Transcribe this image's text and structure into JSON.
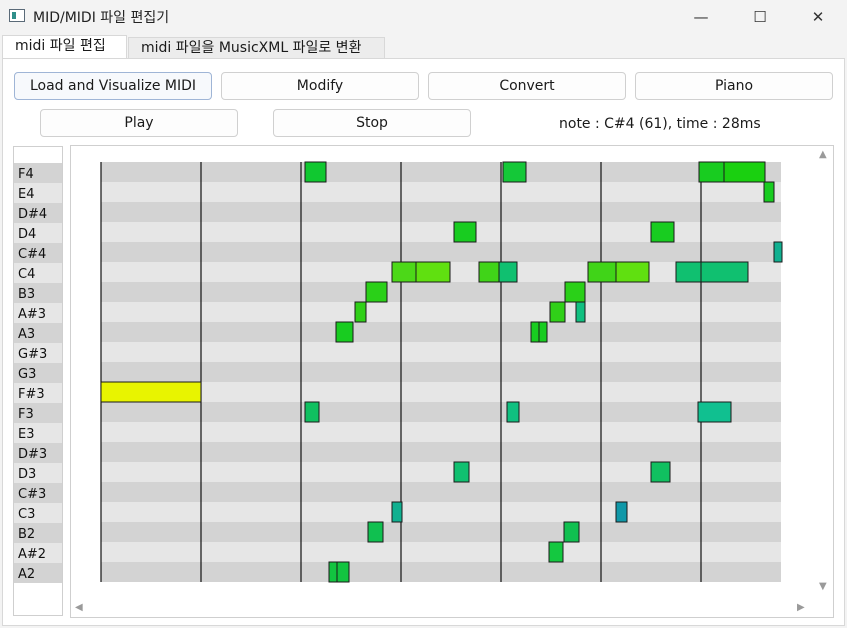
{
  "window": {
    "title": "MID/MIDI 파일 편집기",
    "minimize_icon": "—",
    "maximize_icon": "☐",
    "close_icon": "✕"
  },
  "tabs": [
    {
      "label": "midi 파일 편집",
      "active": true
    },
    {
      "label": "midi 파일을 MusicXML 파일로 변환",
      "active": false
    }
  ],
  "toolbar": {
    "load_label": "Load and Visualize MIDI",
    "modify_label": "Modify",
    "convert_label": "Convert",
    "piano_label": "Piano",
    "play_label": "Play",
    "stop_label": "Stop"
  },
  "status": {
    "text": "note : C#4 (61), time : 28ms"
  },
  "piano_roll": {
    "pitches": [
      "F4",
      "E4",
      "D#4",
      "D4",
      "C#4",
      "C4",
      "B3",
      "A#3",
      "A3",
      "G#3",
      "G3",
      "F#3",
      "F3",
      "E3",
      "D#3",
      "D3",
      "C#3",
      "C3",
      "B2",
      "A#2",
      "A2"
    ],
    "row_colors": {
      "dark": "#d3d3d3",
      "light": "#e6e6e6"
    },
    "beats": 7,
    "notes": [
      {
        "pitch": "F#3",
        "start": 0.0,
        "dur": 1.0,
        "color": "#e8f400"
      },
      {
        "pitch": "F4",
        "start": 2.04,
        "dur": 0.21,
        "color": "#10c830"
      },
      {
        "pitch": "F3",
        "start": 2.04,
        "dur": 0.14,
        "color": "#10c060"
      },
      {
        "pitch": "A2",
        "start": 2.28,
        "dur": 0.08,
        "color": "#12c440"
      },
      {
        "pitch": "A2",
        "start": 2.36,
        "dur": 0.12,
        "color": "#12c440"
      },
      {
        "pitch": "A3",
        "start": 2.35,
        "dur": 0.17,
        "color": "#18cc20"
      },
      {
        "pitch": "A#3",
        "start": 2.54,
        "dur": 0.11,
        "color": "#30d018"
      },
      {
        "pitch": "B2",
        "start": 2.67,
        "dur": 0.15,
        "color": "#10c050"
      },
      {
        "pitch": "B3",
        "start": 2.65,
        "dur": 0.21,
        "color": "#2ad018"
      },
      {
        "pitch": "C4",
        "start": 2.91,
        "dur": 0.24,
        "color": "#4cd818"
      },
      {
        "pitch": "C4",
        "start": 3.15,
        "dur": 0.34,
        "color": "#60e010"
      },
      {
        "pitch": "C3",
        "start": 2.91,
        "dur": 0.1,
        "color": "#10b090"
      },
      {
        "pitch": "D4",
        "start": 3.53,
        "dur": 0.22,
        "color": "#18cc20"
      },
      {
        "pitch": "D3",
        "start": 3.53,
        "dur": 0.15,
        "color": "#10c070"
      },
      {
        "pitch": "C4",
        "start": 3.78,
        "dur": 0.2,
        "color": "#40d418"
      },
      {
        "pitch": "C4",
        "start": 3.98,
        "dur": 0.18,
        "color": "#10c070"
      },
      {
        "pitch": "F4",
        "start": 4.02,
        "dur": 0.23,
        "color": "#14c838"
      },
      {
        "pitch": "F3",
        "start": 4.06,
        "dur": 0.12,
        "color": "#10c080"
      },
      {
        "pitch": "A3",
        "start": 4.3,
        "dur": 0.08,
        "color": "#18cc20"
      },
      {
        "pitch": "A3",
        "start": 4.38,
        "dur": 0.08,
        "color": "#18cc20"
      },
      {
        "pitch": "A#2",
        "start": 4.48,
        "dur": 0.14,
        "color": "#14c840"
      },
      {
        "pitch": "A#3",
        "start": 4.49,
        "dur": 0.15,
        "color": "#30d018"
      },
      {
        "pitch": "B2",
        "start": 4.63,
        "dur": 0.15,
        "color": "#10c050"
      },
      {
        "pitch": "B3",
        "start": 4.64,
        "dur": 0.2,
        "color": "#2ad018"
      },
      {
        "pitch": "A#3",
        "start": 4.75,
        "dur": 0.09,
        "color": "#10c080"
      },
      {
        "pitch": "C4",
        "start": 4.87,
        "dur": 0.28,
        "color": "#40d418"
      },
      {
        "pitch": "C4",
        "start": 5.15,
        "dur": 0.33,
        "color": "#60e010"
      },
      {
        "pitch": "C3",
        "start": 5.15,
        "dur": 0.11,
        "color": "#1098a8"
      },
      {
        "pitch": "D4",
        "start": 5.5,
        "dur": 0.23,
        "color": "#18cc20"
      },
      {
        "pitch": "D3",
        "start": 5.5,
        "dur": 0.19,
        "color": "#10c060"
      },
      {
        "pitch": "C4",
        "start": 5.75,
        "dur": 0.25,
        "color": "#10c070"
      },
      {
        "pitch": "C4",
        "start": 6.0,
        "dur": 0.47,
        "color": "#10c070"
      },
      {
        "pitch": "F4",
        "start": 5.98,
        "dur": 0.25,
        "color": "#18cc20"
      },
      {
        "pitch": "F4",
        "start": 6.23,
        "dur": 0.41,
        "color": "#1ad010"
      },
      {
        "pitch": "F3",
        "start": 5.97,
        "dur": 0.33,
        "color": "#10c090"
      },
      {
        "pitch": "E4",
        "start": 6.63,
        "dur": 0.1,
        "color": "#18cc20"
      },
      {
        "pitch": "C#4",
        "start": 6.73,
        "dur": 0.08,
        "color": "#10b090"
      }
    ]
  }
}
